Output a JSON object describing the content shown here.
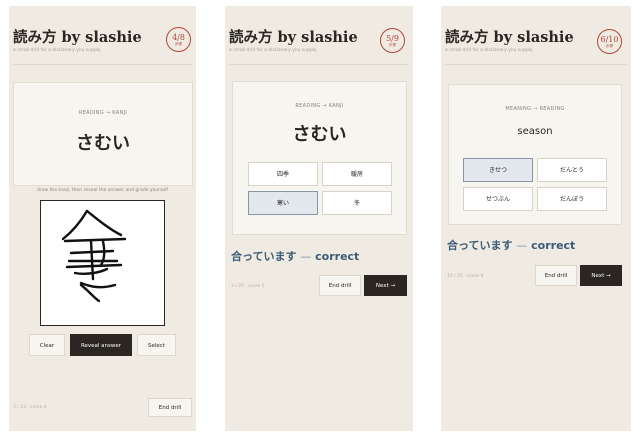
{
  "app_title": "読み方 by slashie",
  "subtitle": "a small drill for a dictionary you supply",
  "accent_color": "#b3453a",
  "correct_color": "#3c5a78",
  "screens": [
    {
      "progress": "4/8",
      "progress_unit": "步骤",
      "direction": "READING → KANJI",
      "prompt": "さむい",
      "hint": "draw the kanji, then reveal the answer and grade yourself",
      "buttons": {
        "clear": "Clear",
        "reveal": "Reveal answer",
        "select": "Select"
      },
      "status": "3 / 23 · score 4",
      "end_drill": "End drill"
    },
    {
      "progress": "5/9",
      "progress_unit": "步骤",
      "direction": "READING → KANJI",
      "prompt": "さむい",
      "options": [
        "四季",
        "暖房",
        "寒い",
        "冬"
      ],
      "selected_index": 2,
      "feedback": "合っています",
      "feedback_sep": "—",
      "feedback_en": "correct",
      "status": "3 / 25 · score 5",
      "end_drill": "End drill",
      "next": "Next →"
    },
    {
      "progress": "6/10",
      "progress_unit": "步骤",
      "direction": "MEANING → READING",
      "prompt": "season",
      "options": [
        "きせつ",
        "だんとう",
        "せつぶん",
        "だんぼう"
      ],
      "selected_index": 0,
      "feedback": "合っています",
      "feedback_sep": "—",
      "feedback_en": "correct",
      "status": "10 / 25 · score 6",
      "end_drill": "End drill",
      "next": "Next →"
    }
  ]
}
